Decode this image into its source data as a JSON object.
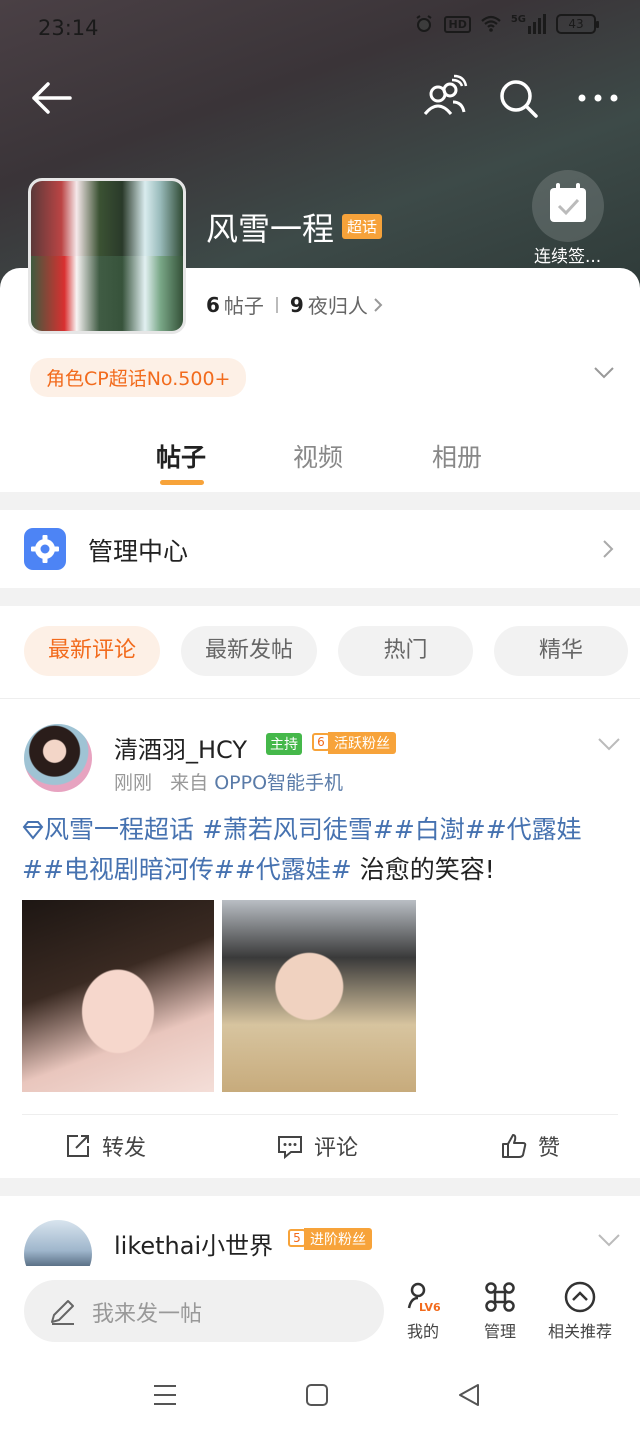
{
  "status_bar": {
    "time": "23:14",
    "hd": "HD",
    "network": "5G",
    "battery": "43"
  },
  "header": {
    "title": "风雪一程",
    "badge": "超话",
    "checkin_label": "连续签...",
    "stats": {
      "posts_count": "6",
      "posts_label": "帖子",
      "members_count": "9",
      "members_label": "夜归人"
    },
    "rank_chip": "角色CP超话No.500+"
  },
  "tabs": [
    {
      "label": "帖子"
    },
    {
      "label": "视频"
    },
    {
      "label": "相册"
    }
  ],
  "management": {
    "label": "管理中心"
  },
  "filters": [
    {
      "label": "最新评论"
    },
    {
      "label": "最新发帖"
    },
    {
      "label": "热门"
    },
    {
      "label": "精华"
    }
  ],
  "post": {
    "username": "清酒羽_HCY",
    "host_tag": "主持",
    "fan_level": "6",
    "fan_tag": "活跃粉丝",
    "time": "刚刚",
    "from_prefix": "来自",
    "device": "OPPO智能手机",
    "text_topics": "风雪一程超话 #萧若风司徒雪##白澍##代露娃##电视剧暗河传##代露娃#",
    "text_plain": " 治愈的笑容!",
    "actions": {
      "repost": "转发",
      "comment": "评论",
      "like": "赞"
    }
  },
  "post2": {
    "username": "likethai小世界",
    "fan_level": "5",
    "fan_tag": "进阶粉丝"
  },
  "bottom_bar": {
    "compose_placeholder": "我来发一帖",
    "mine": "我的",
    "mine_badge": "LV6",
    "manage": "管理",
    "related": "相关推荐"
  },
  "colors": {
    "accent": "#f7a33a",
    "accent_text": "#f26b1d",
    "topic_link": "#4672b0",
    "host_green": "#45b84a",
    "mgmt_blue": "#4d84f5"
  }
}
